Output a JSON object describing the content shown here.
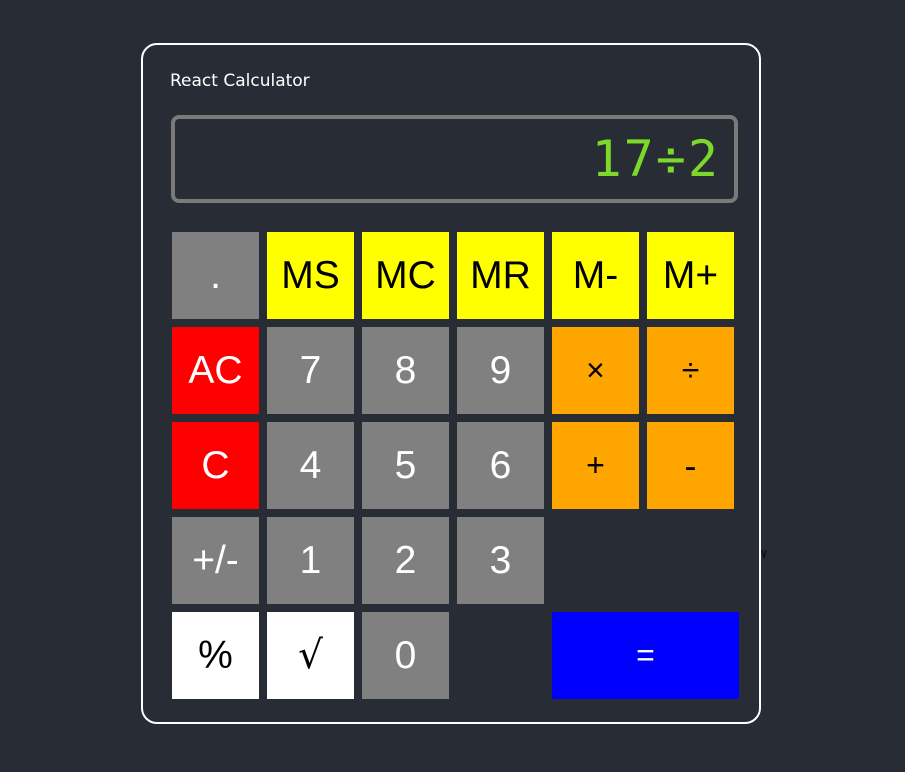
{
  "app": {
    "title": "React Calculator"
  },
  "display": {
    "value": "17÷2",
    "color": "#7cd92a"
  },
  "buttons": {
    "decimal": ".",
    "memory_store": "MS",
    "memory_clear": "MC",
    "memory_recall": "MR",
    "memory_subtract": "M-",
    "memory_add": "M+",
    "all_clear": "AC",
    "seven": "7",
    "eight": "8",
    "nine": "9",
    "multiply": "×",
    "divide": "÷",
    "clear": "C",
    "four": "4",
    "five": "5",
    "six": "6",
    "add": "+",
    "subtract": "-",
    "negate": "+/-",
    "one": "1",
    "two": "2",
    "three": "3",
    "percent": "%",
    "square_root": "√",
    "zero": "0",
    "equals": "="
  },
  "colors": {
    "background": "#282c34",
    "digit": "#808080",
    "memory": "#ffff00",
    "clear": "#ff0000",
    "operator": "#ffa500",
    "function": "#ffffff",
    "equals": "#0000ff"
  }
}
